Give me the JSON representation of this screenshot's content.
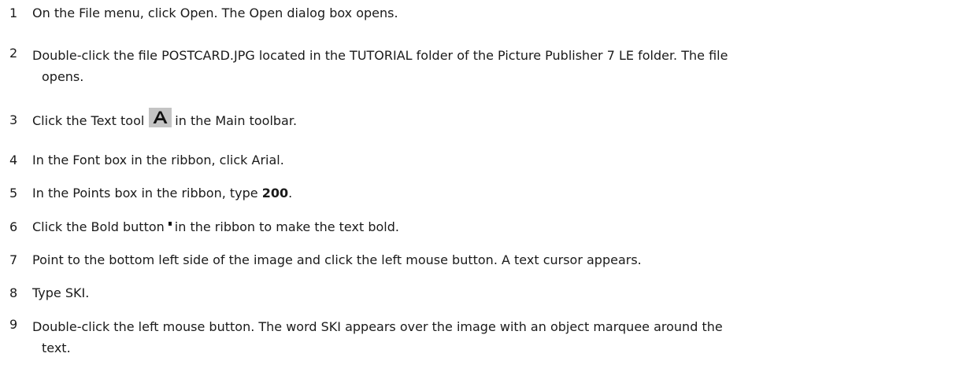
{
  "steps": [
    {
      "number": "1",
      "text": "On the File menu, click Open. The Open dialog box opens."
    },
    {
      "number": "2",
      "text": "Double-click the file POSTCARD.JPG located in the TUTORIAL folder of the Picture Publisher 7 LE folder. The file",
      "text_cont": "opens."
    },
    {
      "number": "3",
      "text_before": "Click the Text tool",
      "icon": "text-tool-icon",
      "text_after": "in the Main toolbar."
    },
    {
      "number": "4",
      "text": "In the Font box in the ribbon, click Arial."
    },
    {
      "number": "5",
      "text_before": "In the Points box in the ribbon, type ",
      "bold": "200",
      "text_after": "."
    },
    {
      "number": "6",
      "text_before": "Click the Bold button",
      "icon": "bold-button-icon",
      "text_after": "in the ribbon to make the text bold."
    },
    {
      "number": "7",
      "text": "Point to the bottom left side of the image and click the left mouse button. A text cursor appears."
    },
    {
      "number": "8",
      "text": "Type SKI."
    },
    {
      "number": "9",
      "text": "Double-click the left mouse button. The word SKI appears over the image with an object marquee around the",
      "text_cont": "text."
    }
  ]
}
